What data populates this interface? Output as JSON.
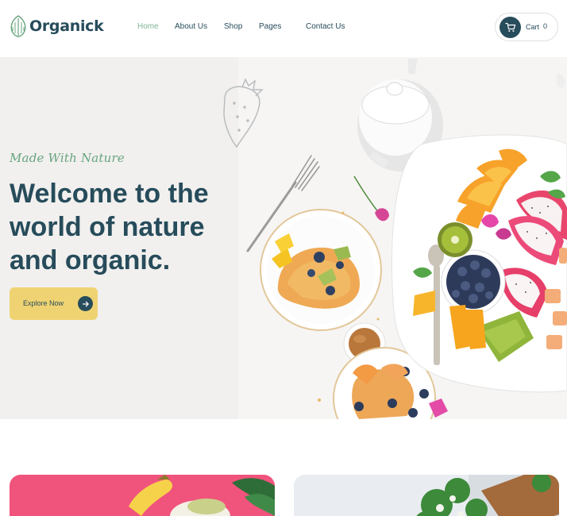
{
  "brand": {
    "name": "Organick",
    "logo_icon": "leaf-logo-icon",
    "logo_color": "#68a47f"
  },
  "nav": {
    "items": [
      {
        "label": "Home",
        "active": true
      },
      {
        "label": "About Us",
        "active": false
      },
      {
        "label": "Shop",
        "active": false
      },
      {
        "label": "Pages",
        "active": false
      },
      {
        "label": "Contact Us",
        "active": false
      }
    ]
  },
  "cart": {
    "label": "Cart",
    "count": "0",
    "icon": "cart-icon"
  },
  "hero": {
    "tagline": "Made With Nature",
    "headline_lines": [
      "Welcome to the",
      "world of nature",
      "and organic."
    ],
    "button_label": "Explore Now",
    "button_icon": "arrow-right-icon",
    "background_color": "#f1f0ee"
  },
  "colors": {
    "primary": "#274c5b",
    "accent": "#7eb693",
    "button": "#efd372",
    "card_left": "#f0537c",
    "card_right": "#e9edf2"
  }
}
